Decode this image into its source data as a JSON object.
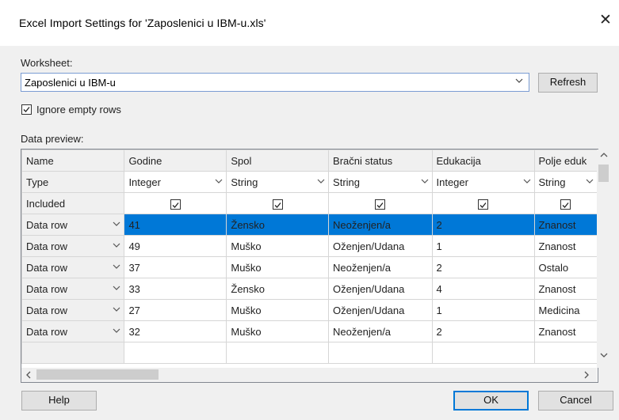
{
  "window": {
    "title": "Excel Import Settings for 'Zaposlenici u IBM-u.xls'",
    "close_glyph": "✕"
  },
  "worksheet": {
    "label": "Worksheet:",
    "selected": "Zaposlenici u IBM-u",
    "refresh_label": "Refresh"
  },
  "ignore_empty_rows": {
    "label": "Ignore empty rows",
    "checked": true
  },
  "preview": {
    "label": "Data preview:",
    "row_headers": {
      "name": "Name",
      "type": "Type",
      "included": "Included"
    },
    "columns": [
      {
        "name": "Godine",
        "type": "Integer"
      },
      {
        "name": "Spol",
        "type": "String"
      },
      {
        "name": "Bračni status",
        "type": "String"
      },
      {
        "name": "Edukacija",
        "type": "Integer"
      },
      {
        "name": "Polje eduk",
        "type": "String"
      }
    ],
    "rows": [
      {
        "kind": "Data row",
        "cells": [
          "41",
          "Žensko",
          "Neoženjen/a",
          "2",
          "Znanost"
        ],
        "selected": true
      },
      {
        "kind": "Data row",
        "cells": [
          "49",
          "Muško",
          "Oženjen/Udana",
          "1",
          "Znanost"
        ]
      },
      {
        "kind": "Data row",
        "cells": [
          "37",
          "Muško",
          "Neoženjen/a",
          "2",
          "Ostalo"
        ]
      },
      {
        "kind": "Data row",
        "cells": [
          "33",
          "Žensko",
          "Oženjen/Udana",
          "4",
          "Znanost"
        ]
      },
      {
        "kind": "Data row",
        "cells": [
          "27",
          "Muško",
          "Oženjen/Udana",
          "1",
          "Medicina"
        ]
      },
      {
        "kind": "Data row",
        "cells": [
          "32",
          "Muško",
          "Neoženjen/a",
          "2",
          "Znanost"
        ]
      }
    ]
  },
  "footer": {
    "help_label": "Help",
    "ok_label": "OK",
    "cancel_label": "Cancel"
  },
  "colors": {
    "selection": "#0078d7",
    "header_bg": "#f0f0f0"
  }
}
